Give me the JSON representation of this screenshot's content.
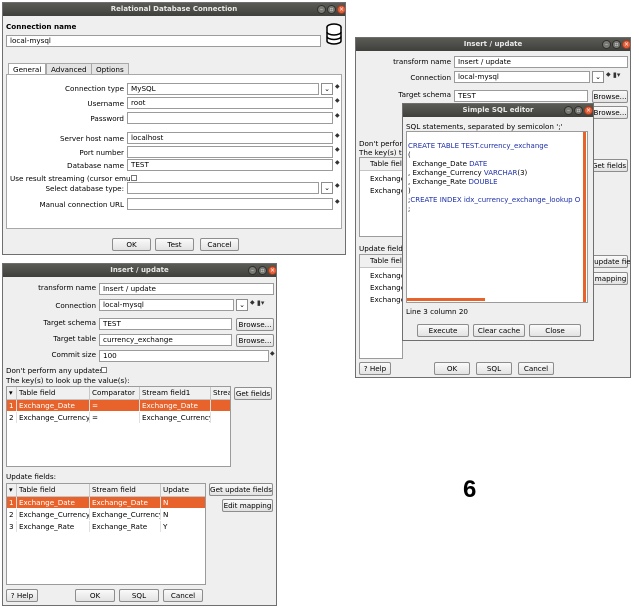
{
  "rdb": {
    "title": "Relational Database Connection",
    "connection_name_label": "Connection name",
    "connection_name": "local-mysql",
    "tabs": [
      "General",
      "Advanced",
      "Options"
    ],
    "connection_type_label": "Connection type",
    "connection_type": "MySQL",
    "username_label": "Username",
    "username": "root",
    "password_label": "Password",
    "password": "",
    "server_host_label": "Server host name",
    "server_host": "localhost",
    "port_label": "Port number",
    "port": "",
    "database_label": "Database name",
    "database": "TEST",
    "result_streaming_label": "Use result streaming (cursor emula",
    "db_type_label": "Select database type:",
    "db_type": "",
    "manual_url_label": "Manual connection URL",
    "manual_url": "",
    "ok": "OK",
    "test": "Test",
    "cancel": "Cancel"
  },
  "iu_back": {
    "title": "Insert / update",
    "transform_name_label": "transform name",
    "transform_name": "Insert / update",
    "connection_label": "Connection",
    "connection": "local-mysql",
    "target_schema_label": "Target schema",
    "target_schema": "TEST",
    "browse": "Browse...",
    "dont_perform": "Don't perform",
    "keys_label": "The key(s) to lo",
    "table_field": "Table field",
    "rows1": [
      "Exchange",
      "Exchange"
    ],
    "get_fields": "Get fields",
    "update_fields_label": "Update fields",
    "rows2": [
      "Exchange",
      "Exchange",
      "Exchange"
    ],
    "get_update": "t update fields",
    "edit_mapping": "t mapping",
    "help": "Help",
    "ok": "OK",
    "sql": "SQL",
    "cancel": "Cancel"
  },
  "sql_editor": {
    "title": "Simple SQL editor",
    "hint": "SQL statements, separated by semicolon ';'",
    "line1_kw": "CREATE TABLE",
    "line1_rest": " TEST.currency_exchange",
    "line2": "(",
    "line3_name": "  Exchange_Date ",
    "line3_type": "DATE",
    "line4_name": ", Exchange_Currency ",
    "line4_type": "VARCHAR",
    "line4_rest": "(3)",
    "line5_name": ", Exchange_Rate ",
    "line5_type": "DOUBLE",
    "line6": ")",
    "line7": ";",
    "line8_kw": "CREATE INDEX",
    "line8_rest": " idx_currency_exchange_lookup O",
    "line9": ";",
    "status": "Line 3 column 20",
    "execute": "Execute",
    "clear_cache": "Clear cache",
    "close": "Close"
  },
  "iu_front": {
    "title": "Insert / update",
    "transform_name_label": "transform name",
    "transform_name": "Insert / update",
    "connection_label": "Connection",
    "connection": "local-mysql",
    "target_schema_label": "Target schema",
    "target_schema": "TEST",
    "target_table_label": "Target table",
    "target_table": "currency_exchange",
    "commit_size_label": "Commit size",
    "commit_size": "100",
    "browse": "Browse...",
    "dont_perform": "Don't perform any updates:",
    "keys_label": "The key(s) to look up the value(s):",
    "key_cols": [
      "Table field",
      "Comparator",
      "Stream field1",
      "Strean"
    ],
    "key_rows": [
      {
        "n": "1",
        "field": "Exchange_Date",
        "comp": "=",
        "stream": "Exchange_Date"
      },
      {
        "n": "2",
        "field": "Exchange_Currency",
        "comp": "=",
        "stream": "Exchange_Currency"
      }
    ],
    "get_fields": "Get fields",
    "update_fields_label": "Update fields:",
    "upd_cols": [
      "Table field",
      "Stream field",
      "Update"
    ],
    "upd_rows": [
      {
        "n": "1",
        "field": "Exchange_Date",
        "stream": "Exchange_Date",
        "upd": "N"
      },
      {
        "n": "2",
        "field": "Exchange_Currency",
        "stream": "Exchange_Currency",
        "upd": "N"
      },
      {
        "n": "3",
        "field": "Exchange_Rate",
        "stream": "Exchange_Rate",
        "upd": "Y"
      }
    ],
    "get_update": "Get update fields",
    "edit_mapping": "Edit mapping",
    "help": "Help",
    "ok": "OK",
    "sql": "SQL",
    "cancel": "Cancel"
  },
  "step_number": "6"
}
